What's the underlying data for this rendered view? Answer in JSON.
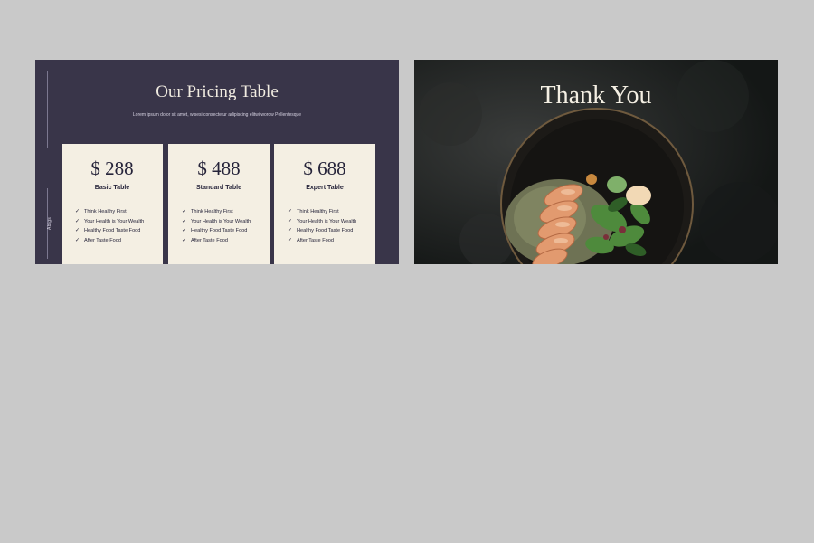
{
  "pricing_slide": {
    "title": "Our Pricing Table",
    "subtitle": "Lorem ipsum dolor sit amet, wisesi consectetur adipiscing elitwi worow Pellentesque",
    "side_label": "Abigs",
    "cards": [
      {
        "price": "$ 288",
        "name": "Basic Table",
        "features": [
          "Think Healthy First",
          "Your Health is Your Wealth",
          "Healthy Food Taste Food",
          "After Taste Food"
        ]
      },
      {
        "price": "$ 488",
        "name": "Standard Table",
        "features": [
          "Think Healthy First",
          "Your Health is Your Wealth",
          "Healthy Food Taste Food",
          "After Taste Food"
        ]
      },
      {
        "price": "$ 688",
        "name": "Expert Table",
        "features": [
          "Think Healthy First",
          "Your Health is Your Wealth",
          "Healthy Food Taste Food",
          "After Taste Food"
        ]
      }
    ],
    "colors": {
      "background": "#393549",
      "card": "#f4efe3",
      "text": "#26243a"
    }
  },
  "thanks_slide": {
    "title": "Thank You",
    "image_name": "salmon-salad-bowl-photo",
    "colors": {
      "background": "#1b1f1e",
      "title": "#f4efe3"
    }
  },
  "icons": {
    "feature_bullet": "check-icon"
  }
}
